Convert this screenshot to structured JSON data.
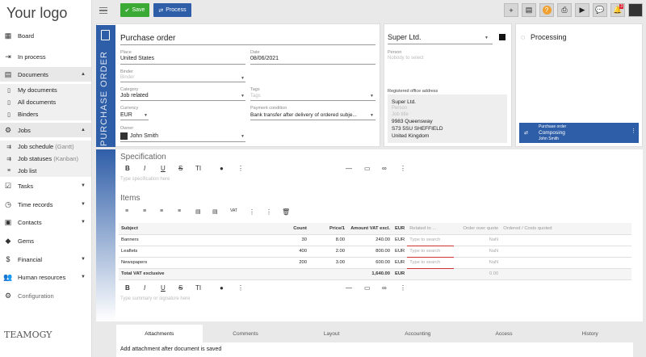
{
  "sidebar": {
    "logo": "Your logo",
    "items": [
      {
        "label": "Board",
        "icon": "grid-icon"
      },
      {
        "label": "In process",
        "icon": "arrow-in-icon"
      },
      {
        "label": "Documents",
        "icon": "document-icon"
      },
      {
        "label": "My documents",
        "icon": "doc-icon"
      },
      {
        "label": "All documents",
        "icon": "doc-icon"
      },
      {
        "label": "Binders",
        "icon": "doc-icon"
      },
      {
        "label": "Jobs",
        "icon": "cogs-icon"
      },
      {
        "label": "Job schedule",
        "suffix": "(Gantt)"
      },
      {
        "label": "Job statuses",
        "suffix": "(Kanban)"
      },
      {
        "label": "Job list"
      },
      {
        "label": "Tasks"
      },
      {
        "label": "Time records"
      },
      {
        "label": "Contacts"
      },
      {
        "label": "Gems"
      },
      {
        "label": "Financial"
      },
      {
        "label": "Human resources"
      },
      {
        "label": "Configuration"
      }
    ],
    "brand": "TEAMOGY"
  },
  "toolbar": {
    "save": "Save",
    "process": "Process",
    "badge": "3"
  },
  "doc": {
    "vertical_title": "PURCHASE ORDER",
    "title": "Purchase order",
    "place_label": "Place",
    "place": "United States",
    "date_label": "Date",
    "date": "08/06/2021",
    "binder_label": "Binder",
    "binder_ph": "Binder",
    "category_label": "Category",
    "category": "Job related",
    "tags_label": "Tags",
    "tags_ph": "Tags",
    "currency_label": "Currency",
    "currency": "EUR",
    "payment_label": "Payment condition",
    "payment": "Bank transfer after delivery of ordered subje...",
    "owner_label": "Owner",
    "owner": "John Smith"
  },
  "company": {
    "name": "Super Ltd.",
    "person_label": "Person",
    "person_ph": "Nobody to select",
    "address_label": "Registered office address",
    "addr_name": "Super Ltd.",
    "addr_person": "Person",
    "addr_job": "Job title",
    "addr_street": "9983 Queensway",
    "addr_city": "S73 5SU SHEFFIELD",
    "addr_country": "United Kingdom"
  },
  "status": {
    "label": "Processing",
    "card_type": "Purchase order",
    "card_state": "Composing",
    "card_owner": "John Smith"
  },
  "spec": {
    "title": "Specification",
    "ph": "Type specification here"
  },
  "items": {
    "title": "Items",
    "summary_ph": "Type summary or signature here",
    "headers": [
      "Subject",
      "Count",
      "Price/1",
      "Amount VAT excl.",
      "EUR",
      "Related to ...",
      "Order over quote",
      "Ordered / Costs quoted"
    ],
    "rows": [
      {
        "subject": "Banners",
        "count": "30",
        "price": "8.00",
        "amount": "240.00",
        "cur": "EUR",
        "related": "Type to search",
        "over": "NaN"
      },
      {
        "subject": "Leaflets",
        "count": "400",
        "price": "2.00",
        "amount": "800.00",
        "cur": "EUR",
        "related": "Type to search",
        "over": "NaN"
      },
      {
        "subject": "Newspapers",
        "count": "200",
        "price": "3.00",
        "amount": "600.00",
        "cur": "EUR",
        "related": "Type to search",
        "over": "NaN"
      }
    ],
    "total_label": "Total VAT exclusive",
    "total": "1,640.00",
    "total_cur": "EUR",
    "total_over": "0.00"
  },
  "tabs": [
    "Attachments",
    "Comments",
    "Layout",
    "Accounting",
    "Access",
    "History"
  ],
  "attach_msg": "Add attachment after document is saved"
}
